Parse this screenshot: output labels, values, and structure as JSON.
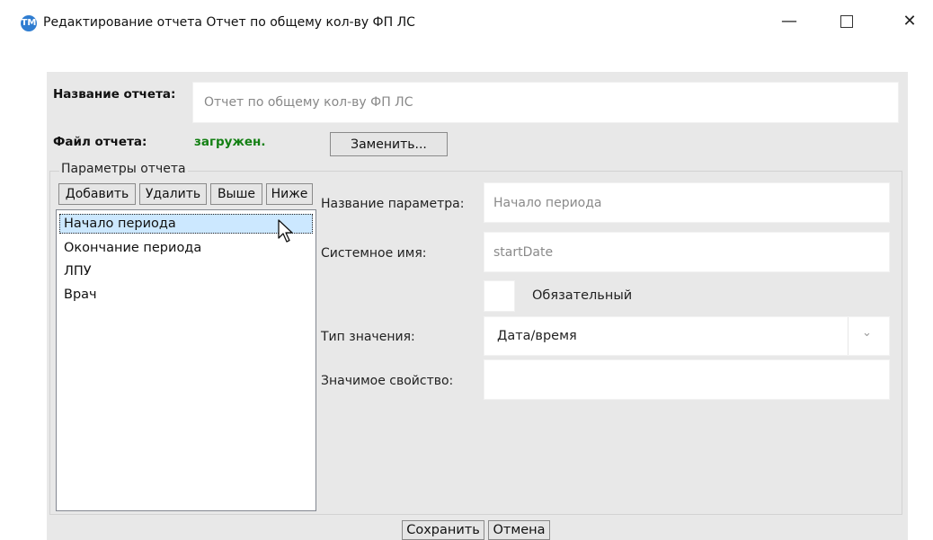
{
  "window": {
    "icon_text": "ТМ",
    "title": "Редактирование отчета Отчет по общему кол-ву ФП ЛС",
    "minimize_glyph": "—",
    "close_glyph": "✕"
  },
  "report": {
    "name_label": "Название отчета:",
    "name_value": "Отчет по общему кол-ву ФП ЛС",
    "file_label": "Файл отчета:",
    "file_status": "загружен.",
    "replace_button": "Заменить..."
  },
  "params": {
    "group_title": "Параметры отчета",
    "buttons": {
      "add": "Добавить",
      "delete": "Удалить",
      "up": "Выше",
      "down": "Ниже"
    },
    "items": [
      {
        "label": "Начало периода",
        "selected": true
      },
      {
        "label": "Окончание периода",
        "selected": false
      },
      {
        "label": "ЛПУ",
        "selected": false
      },
      {
        "label": "Врач",
        "selected": false
      }
    ]
  },
  "details": {
    "param_name_label": "Название параметра:",
    "param_name_value": "Начало периода",
    "system_name_label": "Системное имя:",
    "system_name_value": "startDate",
    "required_label": "Обязательный",
    "required_checked": false,
    "value_type_label": "Тип значения:",
    "value_type_value": "Дата/время",
    "significant_prop_label": "Значимое свойство:",
    "significant_prop_value": ""
  },
  "footer": {
    "save": "Сохранить",
    "cancel": "Отмена"
  },
  "colors": {
    "panel_bg": "#e8e8e8",
    "status_green": "#148014",
    "selection_bg": "#cce8ff",
    "app_icon": "#2f7dd1"
  }
}
